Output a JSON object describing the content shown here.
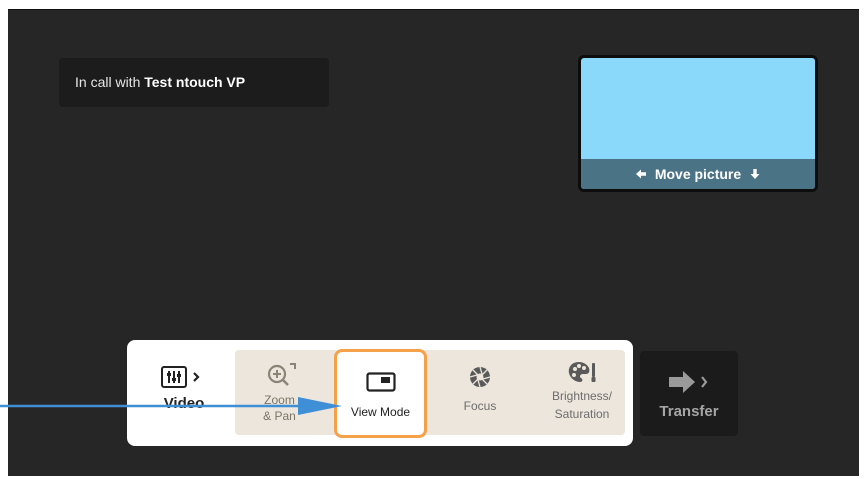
{
  "call": {
    "prefix": "In call with",
    "name": "Test ntouch VP"
  },
  "pip": {
    "move_label": "Move picture",
    "fill_color": "#8ad8fa",
    "bar_color": "#4b7386"
  },
  "toolbar": {
    "video_label": "Video",
    "zoom_label_line1": "Zoom",
    "zoom_label_line2": "& Pan",
    "view_mode_label": "View Mode",
    "focus_label": "Focus",
    "brightness_line1": "Brightness/",
    "brightness_line2": "Saturation",
    "selected": "View Mode",
    "highlight_color": "#f5a14a"
  },
  "transfer": {
    "label": "Transfer"
  },
  "annotation": {
    "arrow_color": "#3f8fd6"
  }
}
